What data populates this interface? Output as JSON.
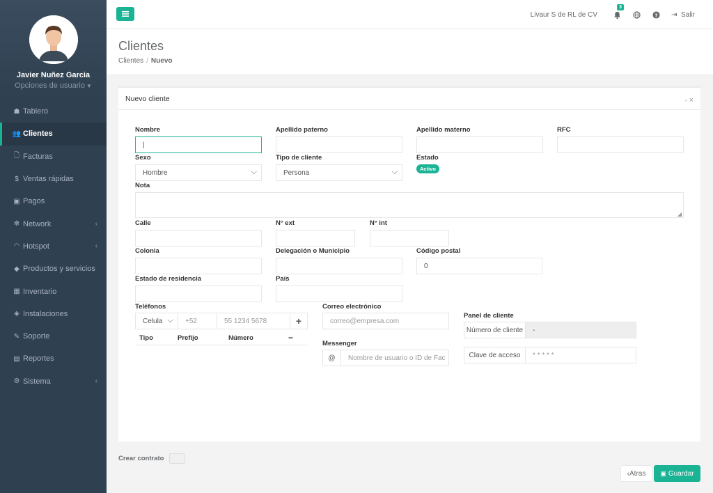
{
  "user": {
    "name": "Javier Nuñez Garcia",
    "options": "Opciones de usuario"
  },
  "nav": [
    {
      "icon": "dashboard-icon",
      "glyph": "☗",
      "label": "Tablero"
    },
    {
      "icon": "users-icon",
      "glyph": "👥",
      "label": "Clientes",
      "active": true
    },
    {
      "icon": "file-icon",
      "glyph": "🗋",
      "label": "Facturas"
    },
    {
      "icon": "dollar-icon",
      "glyph": "$",
      "label": "Ventas rápidas"
    },
    {
      "icon": "money-icon",
      "glyph": "▣",
      "label": "Pagos"
    },
    {
      "icon": "snowflake-icon",
      "glyph": "✻",
      "label": "Network",
      "arrow": true
    },
    {
      "icon": "wifi-icon",
      "glyph": "◠",
      "label": "Hotspot",
      "arrow": true
    },
    {
      "icon": "tags-icon",
      "glyph": "◆",
      "label": "Productos y servicios"
    },
    {
      "icon": "cubes-icon",
      "glyph": "▦",
      "label": "Inventario"
    },
    {
      "icon": "wrench-icon",
      "glyph": "◈",
      "label": "Instalaciones"
    },
    {
      "icon": "support-icon",
      "glyph": "✎",
      "label": "Soporte"
    },
    {
      "icon": "book-icon",
      "glyph": "▤",
      "label": "Reportes"
    },
    {
      "icon": "cogs-icon",
      "glyph": "⚙",
      "label": "Sistema",
      "arrow": true
    }
  ],
  "topbar": {
    "company": "Livaur S de RL de CV",
    "notifications": "3",
    "logout": "Salir"
  },
  "header": {
    "title": "Clientes",
    "crumb_parent": "Clientes",
    "crumb_current": "Nuevo"
  },
  "panel": {
    "title": "Nuevo cliente"
  },
  "form": {
    "nombre_label": "Nombre",
    "nombre_value": "|",
    "ap_paterno_label": "Apellido paterno",
    "ap_materno_label": "Apellido materno",
    "rfc_label": "RFC",
    "sexo_label": "Sexo",
    "sexo_value": "Hombre",
    "tipo_label": "Tipo de cliente",
    "tipo_value": "Persona",
    "estado_label": "Estado",
    "estado_value": "Activo",
    "nota_label": "Nota",
    "calle_label": "Calle",
    "next_label": "N° ext",
    "nint_label": "N° int",
    "colonia_label": "Colonia",
    "delegacion_label": "Delegación o Municipio",
    "cp_label": "Código postal",
    "cp_value": "0",
    "estado_res_label": "Estado de residencia",
    "pais_label": "País",
    "telefonos_label": "Teléfonos",
    "tel_tipo": "Celula",
    "tel_prefijo": "+52",
    "tel_numero": "55 1234 5678",
    "tel_col_tipo": "Tipo",
    "tel_col_prefijo": "Prefijo",
    "tel_col_numero": "Número",
    "correo_label": "Correo electrónico",
    "correo_placeholder": "correo@empresa.com",
    "messenger_label": "Messenger",
    "messenger_placeholder": "Nombre de usuario o ID de Fac",
    "panel_cliente_label": "Panel de cliente",
    "num_cliente_label": "Número de cliente",
    "num_cliente_value": "-",
    "clave_label": "Clave de acceso",
    "clave_value": "* * * * *"
  },
  "footer": {
    "crear_contrato": "Crear contrato",
    "atras": "Atras",
    "guardar": "Guardar"
  },
  "colors": {
    "accent": "#1ab394",
    "sidebar": "#2f4050"
  }
}
